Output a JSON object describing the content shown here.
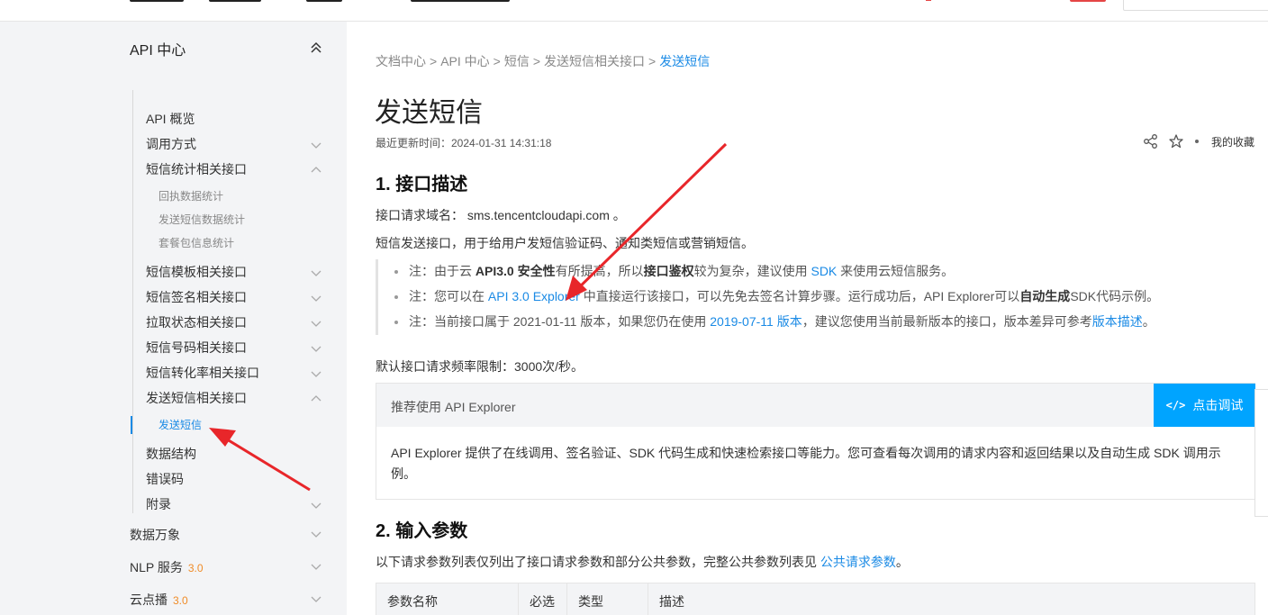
{
  "sidebar": {
    "header": "API 中心",
    "items": [
      {
        "label": "API 概览"
      },
      {
        "label": "调用方式"
      },
      {
        "label": "短信统计相关接口"
      },
      {
        "label": "短信模板相关接口"
      },
      {
        "label": "短信签名相关接口"
      },
      {
        "label": "拉取状态相关接口"
      },
      {
        "label": "短信号码相关接口"
      },
      {
        "label": "短信转化率相关接口"
      },
      {
        "label": "发送短信相关接口"
      },
      {
        "label": "数据结构"
      },
      {
        "label": "错误码"
      },
      {
        "label": "附录"
      }
    ],
    "stats_sub": [
      "回执数据统计",
      "发送短信数据统计",
      "套餐包信息统计"
    ],
    "send_sub": {
      "label": "发送短信"
    },
    "top_level": [
      {
        "label": "数据万象",
        "badge": ""
      },
      {
        "label": "NLP 服务",
        "badge": "3.0"
      },
      {
        "label": "云点播",
        "badge": "3.0"
      }
    ]
  },
  "breadcrumb": {
    "items": [
      "文档中心",
      "API 中心",
      "短信",
      "发送短信相关接口"
    ],
    "current": "发送短信",
    "separator": ">"
  },
  "page": {
    "title": "发送短信",
    "updated": "最近更新时间：2024-01-31 14:31:18",
    "favorite_label": "我的收藏"
  },
  "section1": {
    "heading": "1. 接口描述",
    "domain_prefix": "接口请求域名：",
    "domain": "sms.tencentcloudapi.com",
    "domain_suffix": "。",
    "desc": "短信发送接口，用于给用户发短信验证码、通知类短信或营销短信。",
    "note1": {
      "a": "注：由于云 ",
      "b": "API3.0 安全性",
      "c": "有所提高，所以",
      "d": "接口鉴权",
      "e": "较为复杂，建议使用 ",
      "link": "SDK",
      "f": " 来使用云短信服务。"
    },
    "note2": {
      "a": "注：您可以在 ",
      "link": "API 3.0 Explorer",
      "b": " 中直接运行该接口，可以先免去签名计算步骤。运行成功后，API Explorer可以",
      "c": "自动生成",
      "d": "SDK代码示例。"
    },
    "note3": {
      "a": "注：当前接口属于 2021-01-11 版本，如果您仍在使用 ",
      "link": "2019-07-11 版本",
      "b": "，建议您使用当前最新版本的接口，版本差异可参考",
      "link2": "版本描述",
      "c": "。"
    },
    "rate_limit": "默认接口请求频率限制：3000次/秒。"
  },
  "explorer": {
    "label": "推荐使用 API Explorer",
    "button_icon": "</>",
    "button": "点击调试",
    "body": "API Explorer 提供了在线调用、签名验证、SDK 代码生成和快速检索接口等能力。您可查看每次调用的请求内容和返回结果以及自动生成 SDK 调用示例。"
  },
  "section2": {
    "heading": "2. 输入参数",
    "desc": "以下请求参数列表仅列出了接口请求参数和部分公共参数，完整公共参数列表见 ",
    "link": "公共请求参数",
    "desc_end": "。",
    "columns": [
      "参数名称",
      "必选",
      "类型",
      "描述"
    ]
  },
  "colors": {
    "link": "#1a8ae5",
    "button": "#00a4ff",
    "arrow": "#e8262a",
    "badge": "#f08c28"
  }
}
